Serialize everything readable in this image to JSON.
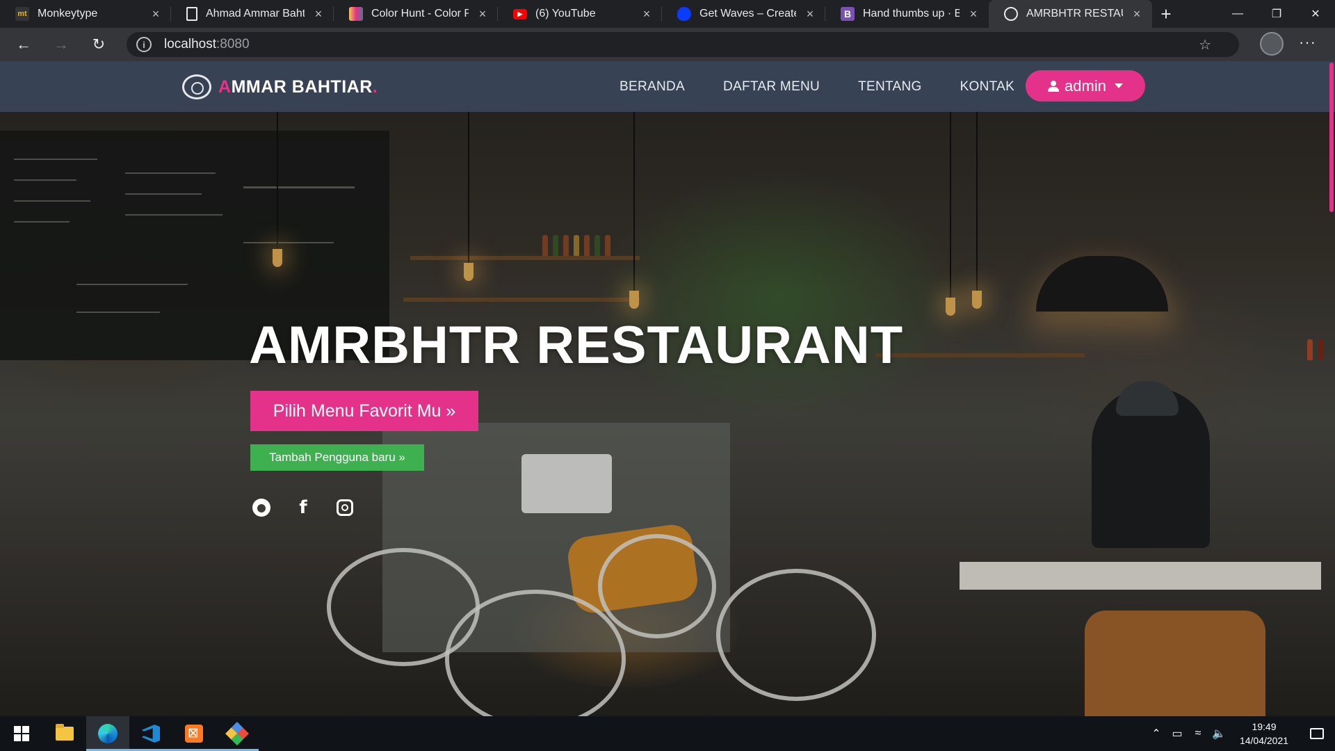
{
  "browser": {
    "tabs": [
      {
        "title": "Monkeytype",
        "favicon": "monkeytype-icon",
        "active": false
      },
      {
        "title": "Ahmad Ammar Bahtiar",
        "favicon": "page-icon",
        "active": false
      },
      {
        "title": "Color Hunt - Color Pale",
        "favicon": "color-hunt-icon",
        "active": false
      },
      {
        "title": "(6) YouTube",
        "favicon": "youtube-icon",
        "active": false
      },
      {
        "title": "Get Waves – Create SV",
        "favicon": "get-waves-icon",
        "active": false
      },
      {
        "title": "Hand thumbs up · Boot",
        "favicon": "bootstrap-icon",
        "active": false
      },
      {
        "title": "AMRBHTR RESTAURAN",
        "favicon": "restaurant-logo-icon",
        "active": true
      }
    ],
    "address": {
      "host": "localhost",
      "port": ":8080"
    }
  },
  "site": {
    "brand": {
      "first_letter": "A",
      "rest": "MMAR BAHTIAR",
      "dot": "."
    },
    "nav": [
      "BERANDA",
      "DAFTAR MENU",
      "TENTANG",
      "KONTAK"
    ],
    "user_menu": {
      "label": "admin",
      "icon": "user-icon"
    },
    "hero": {
      "title": "AMRBHTR RESTAURANT",
      "primary_cta": "Pilih Menu Favorit Mu »",
      "secondary_cta": "Tambah Pengguna baru »",
      "socials": [
        "github-icon",
        "facebook-icon",
        "instagram-icon"
      ]
    },
    "colors": {
      "accent": "#e4318a",
      "success": "#3fb04f",
      "navbar": "#3a4558"
    }
  },
  "taskbar": {
    "apps": [
      "start-icon",
      "file-explorer-icon",
      "edge-icon",
      "vscode-icon",
      "xampp-icon",
      "git-icon"
    ],
    "clock": {
      "time": "19:49",
      "date": "14/04/2021"
    }
  }
}
